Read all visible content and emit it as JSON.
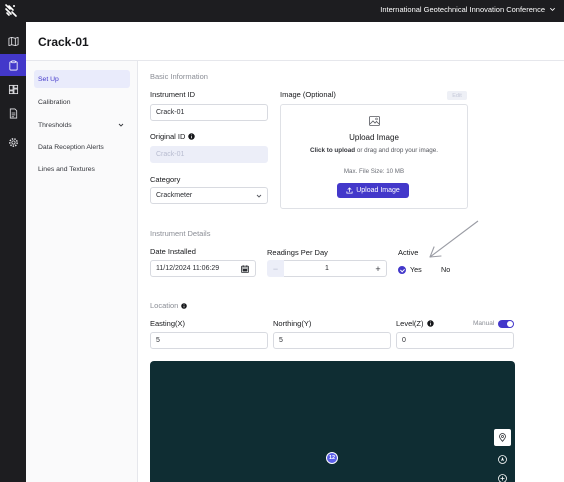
{
  "header": {
    "org_name": "International Geotechnical Innovation Conference"
  },
  "rail": {
    "icons": [
      "map-icon",
      "clipboard-icon",
      "dashboard-icon",
      "report-icon",
      "settings-icon"
    ],
    "active": "clipboard-icon"
  },
  "page": {
    "title": "Crack-01"
  },
  "sidebar": {
    "items": [
      {
        "label": "Set Up",
        "active": true
      },
      {
        "label": "Calibration"
      },
      {
        "label": "Thresholds",
        "expandable": true
      },
      {
        "label": "Data Reception Alerts"
      },
      {
        "label": "Lines and Textures"
      }
    ]
  },
  "basic": {
    "section_title": "Basic Information",
    "instrument_id_label": "Instrument ID",
    "instrument_id_value": "Crack-01",
    "original_id_label": "Original ID",
    "original_id_value": "Crack-01",
    "category_label": "Category",
    "category_value": "Crackmeter",
    "image_label": "Image (Optional)",
    "edit_label": "Edit",
    "upload_title": "Upload Image",
    "upload_hint_bold": "Click to upload",
    "upload_hint_rest": " or drag and drop your image.",
    "upload_max": "Max. File Size: 10 MB",
    "upload_button": "Upload Image"
  },
  "details": {
    "section_title": "Instrument Details",
    "date_label": "Date Installed",
    "date_value": "11/12/2024 11:06:29",
    "readings_label": "Readings Per Day",
    "readings_value": "1",
    "minus": "−",
    "plus": "+",
    "active_label": "Active",
    "yes_label": "Yes",
    "no_label": "No",
    "active_selected": "Yes"
  },
  "location": {
    "section_title": "Location",
    "easting_label": "Easting(X)",
    "easting_value": "5",
    "northing_label": "Northing(Y)",
    "northing_value": "5",
    "level_label": "Level(Z)",
    "level_value": "0",
    "manual_label": "Manual",
    "manual_on": true,
    "map_marker_label": "12"
  },
  "colors": {
    "accent": "#4338ca",
    "rail": "#1d1d20",
    "map": "#0f2d33"
  }
}
